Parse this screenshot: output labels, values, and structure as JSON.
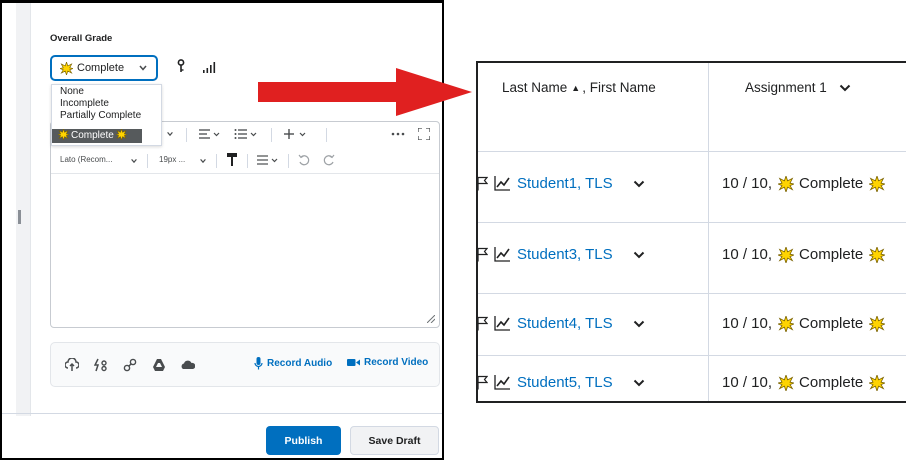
{
  "left_panel": {
    "overall_grade_label": "Overall Grade",
    "grade_select_value": "Complete",
    "dropdown_options": [
      "None",
      "Incomplete",
      "Partially Complete",
      "Complete"
    ],
    "editor": {
      "font_family": "Lato (Recom...",
      "font_size": "19px ..."
    },
    "record_audio_label": "Record Audio",
    "record_video_label": "Record Video",
    "publish_label": "Publish",
    "save_draft_label": "Save Draft"
  },
  "gradebook": {
    "name_header": "Last Name",
    "name_header_sort": "▲",
    "name_header_rest": ", First Name",
    "assignment_header": "Assignment 1",
    "rows": [
      {
        "student": "Student1, TLS",
        "score": "10 / 10,",
        "scheme": "Complete"
      },
      {
        "student": "Student3, TLS",
        "score": "10 / 10,",
        "scheme": "Complete"
      },
      {
        "student": "Student4, TLS",
        "score": "10 / 10,",
        "scheme": "Complete"
      },
      {
        "student": "Student5, TLS",
        "score": "10 / 10,",
        "scheme": "Complete"
      }
    ]
  },
  "colors": {
    "accent_blue": "#006fbf",
    "arrow_red": "#e02020",
    "burst_yellow": "#ffd400"
  }
}
